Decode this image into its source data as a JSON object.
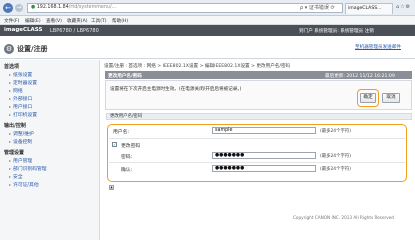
{
  "browser": {
    "address_host": "192.168.1.84",
    "address_path": "/rtd/systemmenu/...",
    "address_tools": "ρ ▾ 证书错误 ⟳",
    "tab_title": "imageCLASS..."
  },
  "menu": [
    "文件(F)",
    "编辑(E)",
    "查看(V)",
    "收藏夹(A)",
    "工具(T)",
    "帮助(H)"
  ],
  "app": {
    "brand": "imageCLASS",
    "model": "LBP6780 / LBP6780",
    "header_right": "到门户  系统管理员: 系统管理员  注销"
  },
  "title_row": {
    "title": "设置/注册",
    "help": "至机器管理员发送邮件"
  },
  "sidebar": {
    "groups": [
      {
        "label": "首选项",
        "items": [
          "纸张设置",
          "定时器设置",
          "网络",
          "外部接口",
          "用户接口",
          "打印机设置"
        ]
      },
      {
        "label": "输出/控制",
        "items": [
          "调整/维护",
          "设备控制"
        ]
      },
      {
        "label": "管理设置",
        "items": [
          "用户管理",
          "部门识别码管理",
          "安全",
          "许可证/其他"
        ]
      }
    ]
  },
  "breadcrumb": "设置/注册 : 首选项 : 网络 > IEEE802.1X设置 > 编辑IEEE802.1X设置 > 更改用户名/密码",
  "update_bar": {
    "title": "更改用户名/密码",
    "time": "最后更新: 2012 11/12 16:21:09"
  },
  "note": {
    "text": "设置将在下次开启主电源时生效。(在电源关闭/开启后将被记录。)",
    "ok_label": "确定",
    "cancel_label": "取消"
  },
  "section": {
    "heading": "更改用户名/密码"
  },
  "form": {
    "username_label": "用户名:",
    "username_value": "sample",
    "username_hint": "(最多24个字符)",
    "change_password_label": "更改密码",
    "change_password_checked": true,
    "password_label": "密码:",
    "password_value": "●●●●●●●",
    "password_hint": "(最多24个字符)",
    "confirm_label": "确认:",
    "confirm_value": "●●●●●●●",
    "confirm_hint": "(最多24个字符)"
  },
  "footer": {
    "copyright": "Copyright CANON INC. 2013 All Rights Reserved"
  },
  "colors": {
    "header_bg": "#4b4f57",
    "highlight_ring": "#f0a020",
    "link": "#2a5aa8"
  }
}
